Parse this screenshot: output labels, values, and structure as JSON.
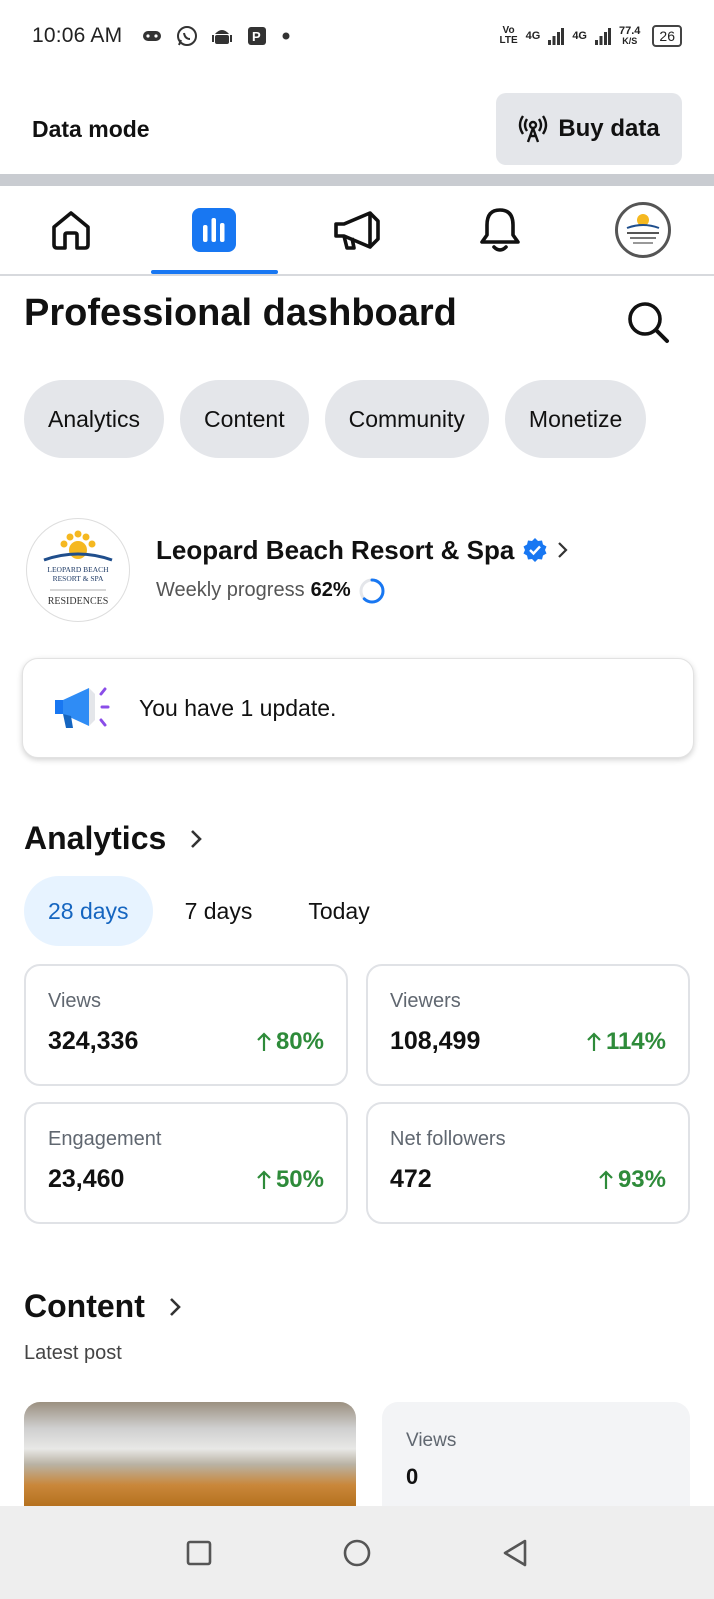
{
  "status_bar": {
    "time": "10:06 AM",
    "net_top": "Vo",
    "net_bottom": "LTE",
    "sig1_label": "4G",
    "sig2_label": "4G",
    "speed_value": "77.4",
    "speed_unit": "K/S",
    "battery": "26"
  },
  "data_mode": {
    "label": "Data mode",
    "buy_label": "Buy data"
  },
  "nav": {
    "active": "analytics",
    "items": [
      "home",
      "analytics",
      "ads",
      "notifications",
      "profile"
    ]
  },
  "header": {
    "title": "Professional dashboard"
  },
  "chips": [
    "Analytics",
    "Content",
    "Community",
    "Monetize"
  ],
  "profile": {
    "name": "Leopard Beach Resort & Spa",
    "progress_label": "Weekly progress",
    "progress_value": "62%",
    "progress_fraction": 0.62,
    "logo_line1": "LEOPARD BEACH",
    "logo_line2": "RESORT & SPA",
    "logo_line3": "RESIDENCES"
  },
  "update": {
    "text": "You have 1 update."
  },
  "analytics": {
    "title": "Analytics",
    "ranges": [
      "28 days",
      "7 days",
      "Today"
    ],
    "active_range": "28 days",
    "stats": [
      {
        "label": "Views",
        "value": "324,336",
        "change": "80%"
      },
      {
        "label": "Viewers",
        "value": "108,499",
        "change": "114%"
      },
      {
        "label": "Engagement",
        "value": "23,460",
        "change": "50%"
      },
      {
        "label": "Net followers",
        "value": "472",
        "change": "93%"
      }
    ]
  },
  "content": {
    "title": "Content",
    "latest_label": "Latest post",
    "post_views_label": "Views",
    "post_views_value": "0"
  },
  "colors": {
    "accent": "#1877f2",
    "positive": "#2e8b3a",
    "chip_bg": "#e4e6ea"
  }
}
